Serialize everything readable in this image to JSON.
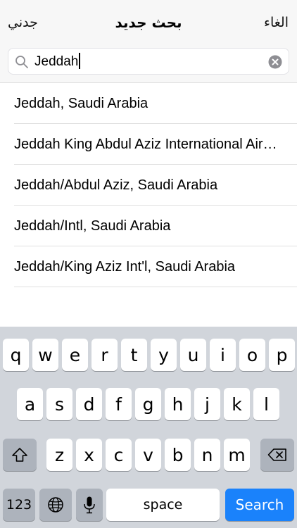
{
  "nav": {
    "left_label": "جدني",
    "title": "بحث جديد",
    "right_label": "الغاء"
  },
  "search": {
    "value": "Jeddah",
    "search_icon": "magnifying-glass-icon",
    "clear_icon": "clear-x-circle-icon"
  },
  "results": [
    {
      "label": "Jeddah, Saudi Arabia"
    },
    {
      "label": "Jeddah King Abdul Aziz International Airport, Saudi Arabia"
    },
    {
      "label": "Jeddah/Abdul Aziz, Saudi Arabia"
    },
    {
      "label": "Jeddah/Intl, Saudi Arabia"
    },
    {
      "label": "Jeddah/King Aziz Int'l, Saudi Arabia"
    }
  ],
  "keyboard": {
    "row1": [
      "q",
      "w",
      "e",
      "r",
      "t",
      "y",
      "u",
      "i",
      "o",
      "p"
    ],
    "row2": [
      "a",
      "s",
      "d",
      "f",
      "g",
      "h",
      "j",
      "k",
      "l"
    ],
    "row3": [
      "z",
      "x",
      "c",
      "v",
      "b",
      "n",
      "m"
    ],
    "shift_icon": "shift-arrow-icon",
    "delete_icon": "backspace-icon",
    "numbers_label": "123",
    "globe_icon": "globe-icon",
    "mic_icon": "microphone-icon",
    "space_label": "space",
    "action_label": "Search"
  },
  "colors": {
    "keyboard_bg": "#d1d5db",
    "special_key": "#adb3bc",
    "search_key": "#1a82fb"
  }
}
